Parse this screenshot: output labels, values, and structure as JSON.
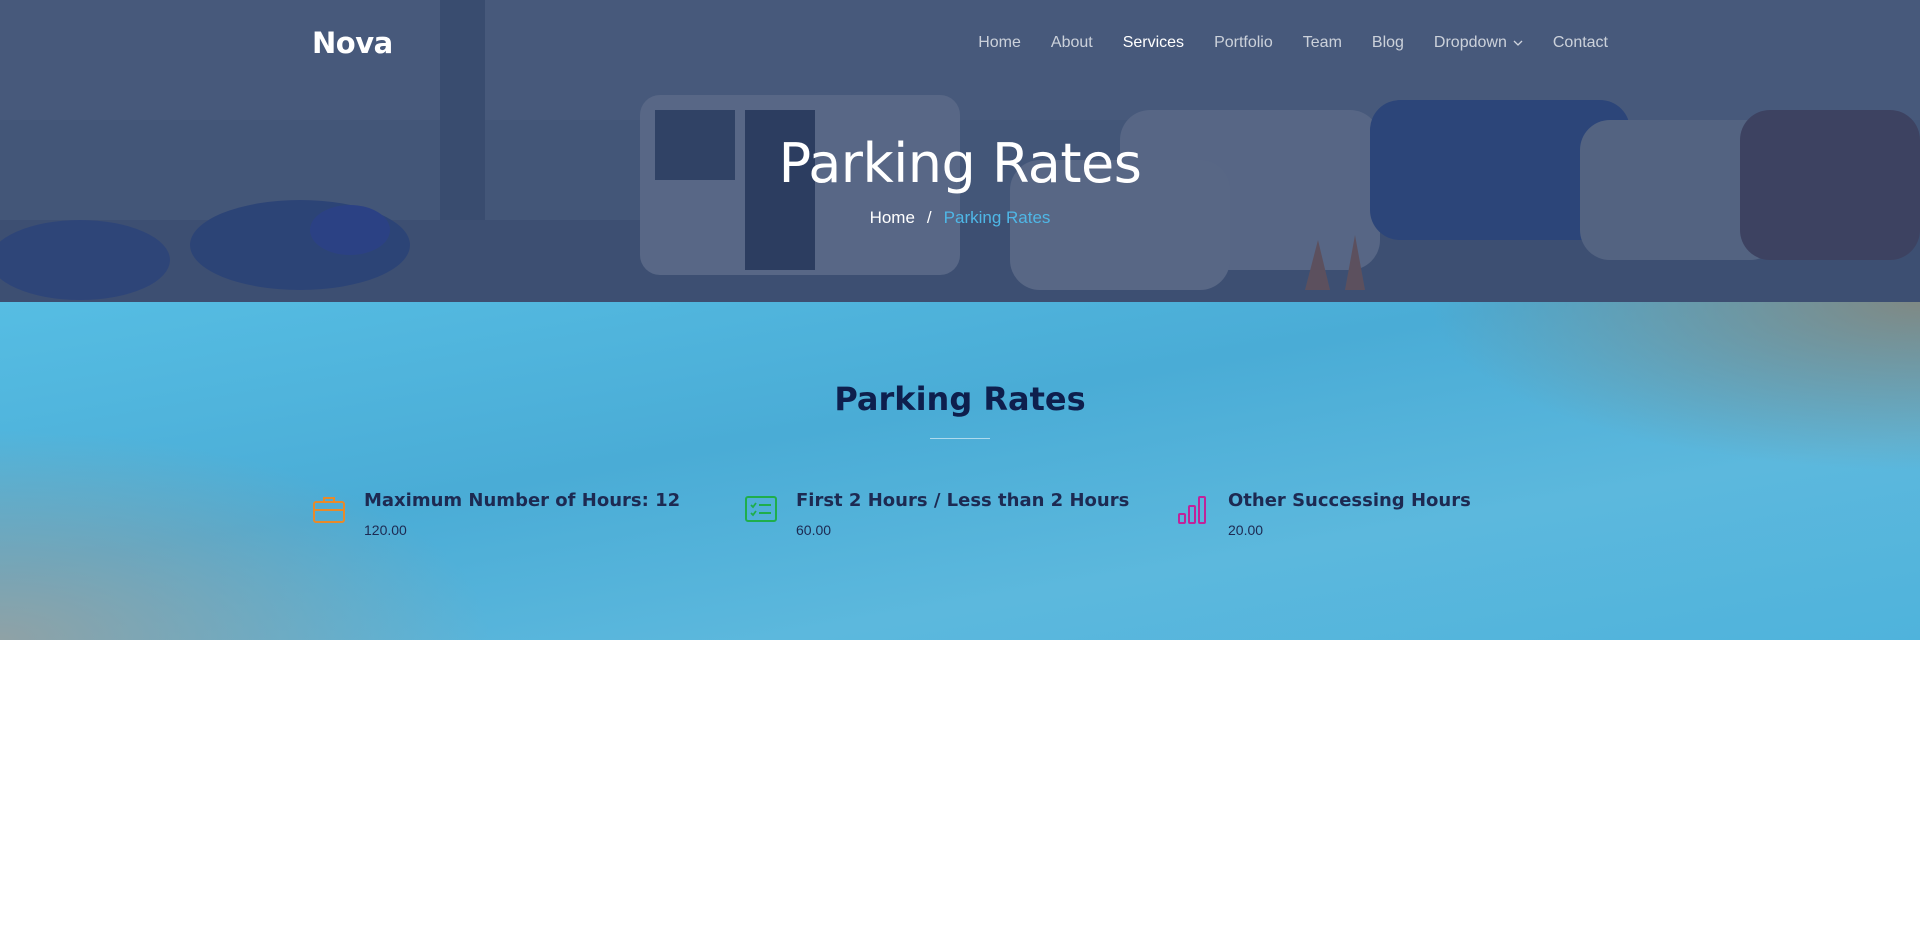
{
  "brand": {
    "logo": "Nova"
  },
  "nav": {
    "items": [
      {
        "label": "Home",
        "active": false
      },
      {
        "label": "About",
        "active": false
      },
      {
        "label": "Services",
        "active": true
      },
      {
        "label": "Portfolio",
        "active": false
      },
      {
        "label": "Team",
        "active": false
      },
      {
        "label": "Blog",
        "active": false
      },
      {
        "label": "Dropdown",
        "active": false,
        "has_dropdown": true
      },
      {
        "label": "Contact",
        "active": false
      }
    ]
  },
  "hero": {
    "title": "Parking Rates",
    "breadcrumb": {
      "home": "Home",
      "separator": "/",
      "current": "Parking Rates"
    }
  },
  "rates": {
    "title": "Parking Rates",
    "items": [
      {
        "icon": "briefcase-icon",
        "color": "#e88a2a",
        "title": "Maximum Number of Hours: 12",
        "value": "120.00"
      },
      {
        "icon": "list-check-icon",
        "color": "#1fae4b",
        "title": "First 2 Hours / Less than 2 Hours",
        "value": "60.00"
      },
      {
        "icon": "bar-chart-icon",
        "color": "#c0239a",
        "title": "Other Successing Hours",
        "value": "20.00"
      }
    ]
  },
  "colors": {
    "accent": "#4fb7e6",
    "heading": "#0e1f4d"
  }
}
